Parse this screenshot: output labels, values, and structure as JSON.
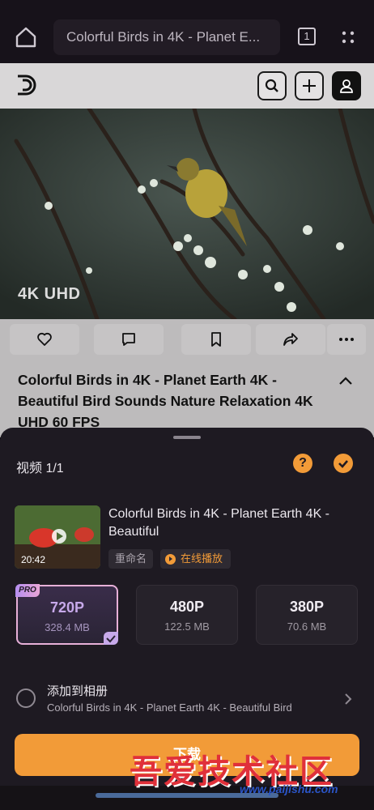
{
  "browser": {
    "url_title": "Colorful Birds in 4K - Planet E...",
    "tab_count": "1",
    "icons": [
      "home-icon",
      "tab-switcher-icon",
      "more-icon"
    ]
  },
  "site": {
    "icons": [
      "site-logo-icon",
      "search-icon",
      "plus-icon",
      "user-icon"
    ]
  },
  "video": {
    "badge": "4K UHD"
  },
  "actions": {
    "icons": [
      "heart-icon",
      "comment-icon",
      "bookmark-icon",
      "share-icon",
      "more-icon"
    ]
  },
  "page": {
    "title": "Colorful Birds in 4K - Planet Earth 4K - Beautiful Bird Sounds Nature Relaxation 4K UHD 60 FPS"
  },
  "sheet": {
    "title": "视频 1/1",
    "help": "?",
    "video_title": "Colorful Birds in 4K - Planet Earth 4K - Beautiful",
    "duration": "20:42",
    "rename": "重命名",
    "play_online": "在线播放",
    "qualities": [
      {
        "res": "720P",
        "size": "328.4 MB",
        "selected": true,
        "badge": "PRO"
      },
      {
        "res": "480P",
        "size": "122.5 MB",
        "selected": false
      },
      {
        "res": "380P",
        "size": "70.6 MB",
        "selected": false
      }
    ],
    "album_title": "添加到相册",
    "album_sub": "Colorful Birds in 4K - Planet Earth 4K - Beautiful Bird",
    "download": "下载"
  },
  "watermark": {
    "text": "吾爱技术社区",
    "url": "www.paijishu.com"
  },
  "colors": {
    "accent": "#f29b38",
    "pro": "#c7a9ea",
    "sheet_bg": "#1e1a22"
  }
}
